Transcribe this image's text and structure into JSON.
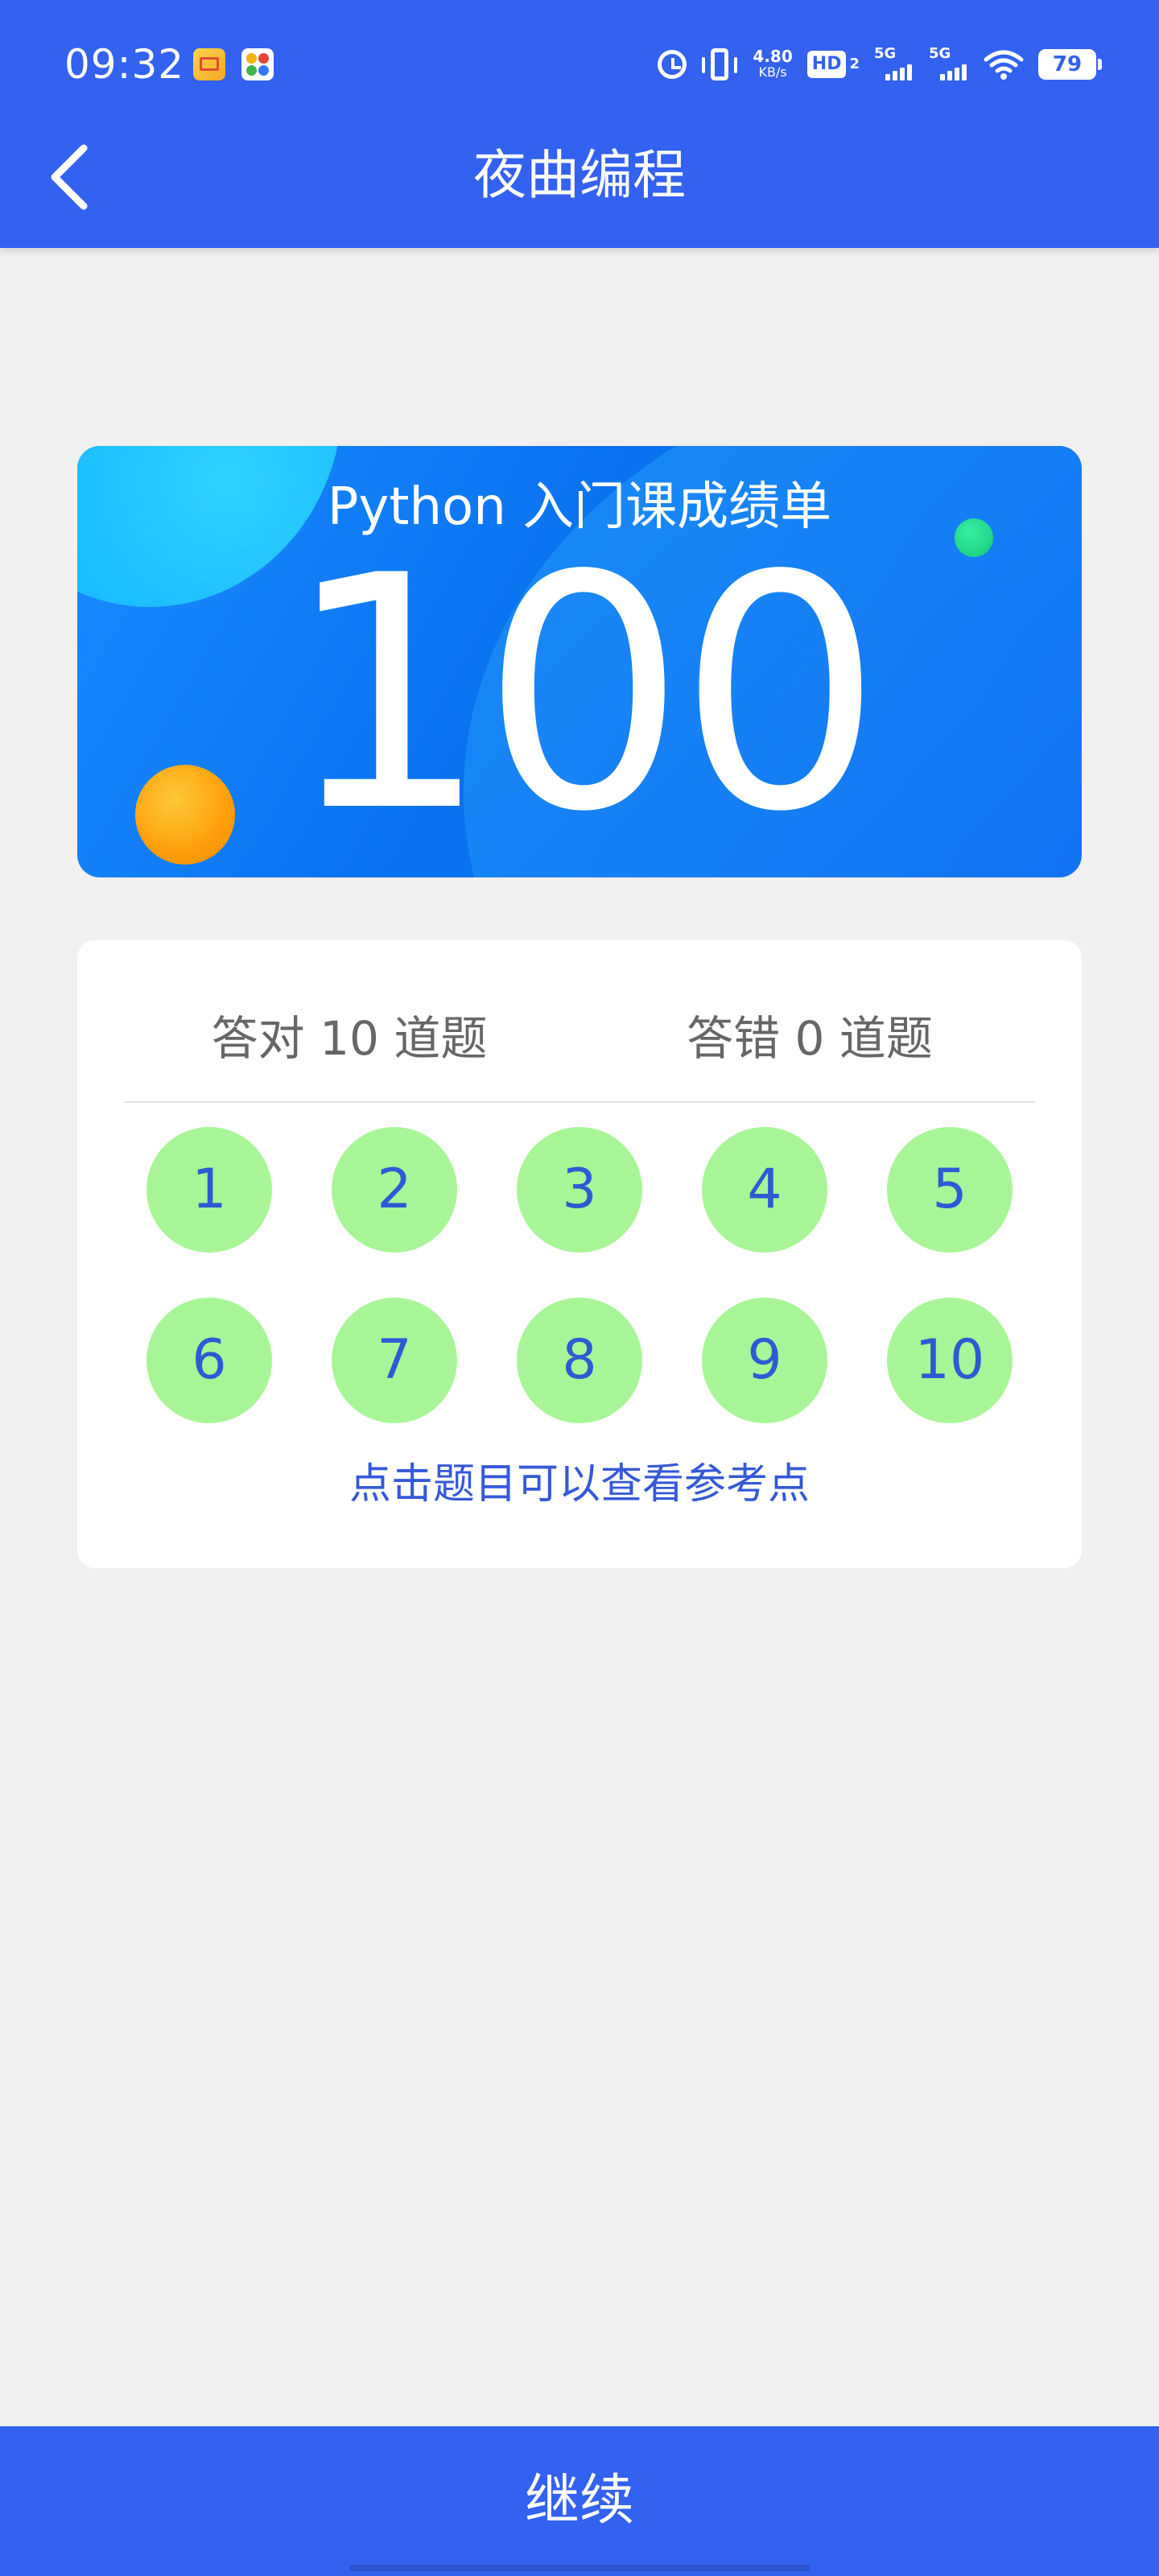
{
  "status_bar": {
    "time": "09:32",
    "net_speed_value": "4.80",
    "net_speed_unit": "KB/s",
    "hd_label": "HD",
    "hd_sub": "2",
    "sim1_label": "5G",
    "sim2_label": "5G",
    "battery": "79",
    "icons": [
      "mail-notification-icon",
      "app-notification-icon",
      "alarm-icon",
      "vibrate-icon",
      "wifi-icon",
      "battery-icon"
    ]
  },
  "header": {
    "title": "夜曲编程",
    "back_icon": "chevron-left-icon"
  },
  "score_card": {
    "title": "Python 入门课成绩单",
    "score": "100"
  },
  "results": {
    "correct_label": "答对 10 道题",
    "wrong_label": "答错 0 道题",
    "questions": [
      "1",
      "2",
      "3",
      "4",
      "5",
      "6",
      "7",
      "8",
      "9",
      "10"
    ],
    "hint": "点击题目可以查看参考点"
  },
  "footer": {
    "continue_label": "继续"
  },
  "colors": {
    "primary": "#3361f0",
    "correct_bg": "#a8f597",
    "number_text": "#2f5ad4",
    "page_bg": "#f0f0f0"
  }
}
